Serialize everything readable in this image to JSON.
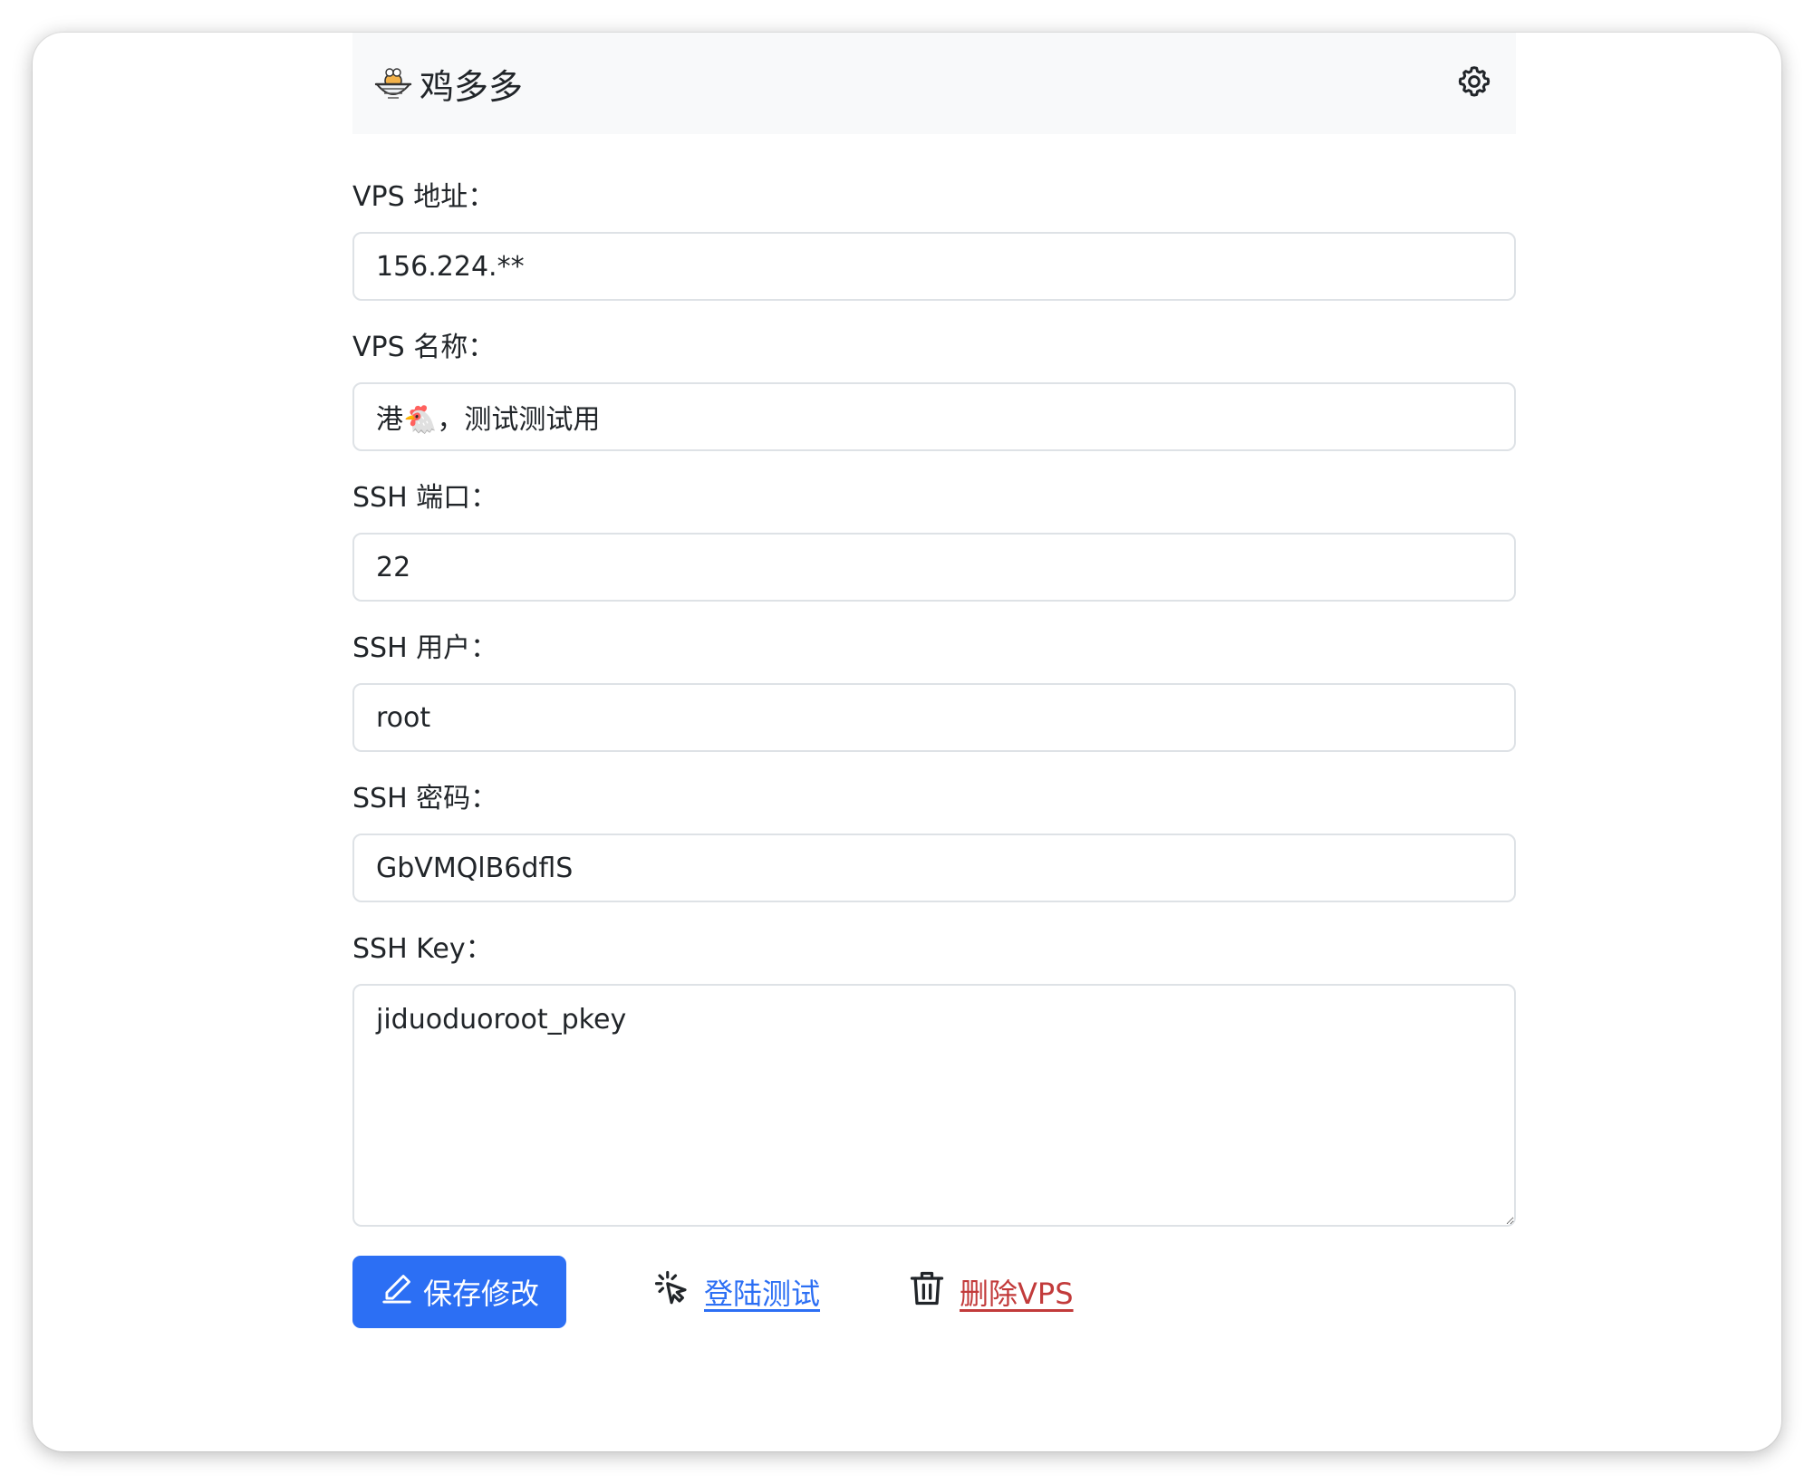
{
  "navbar": {
    "brand": "鸡多多",
    "brand_icon": "chicken-basket-icon",
    "settings_icon": "gear-icon"
  },
  "form": {
    "address": {
      "label": "VPS 地址：",
      "value": "156.224.**"
    },
    "name": {
      "label": "VPS 名称：",
      "value": "港🐔，测试测试用"
    },
    "port": {
      "label": "SSH 端口：",
      "value": "22"
    },
    "user": {
      "label": "SSH 用户：",
      "value": "root"
    },
    "password": {
      "label": "SSH 密码：",
      "value": "GbVMQlB6dflS"
    },
    "key": {
      "label": "SSH Key：",
      "value": "jiduoduoroot_pkey"
    }
  },
  "actions": {
    "save": {
      "label": "保存修改",
      "icon": "pencil-icon",
      "color": "#2c6ff4"
    },
    "test": {
      "label": "登陆测试",
      "icon": "cursor-click-icon",
      "color": "#2c6ff4"
    },
    "delete": {
      "label": "删除VPS",
      "icon": "trash-icon",
      "color": "#c23b3b"
    }
  }
}
